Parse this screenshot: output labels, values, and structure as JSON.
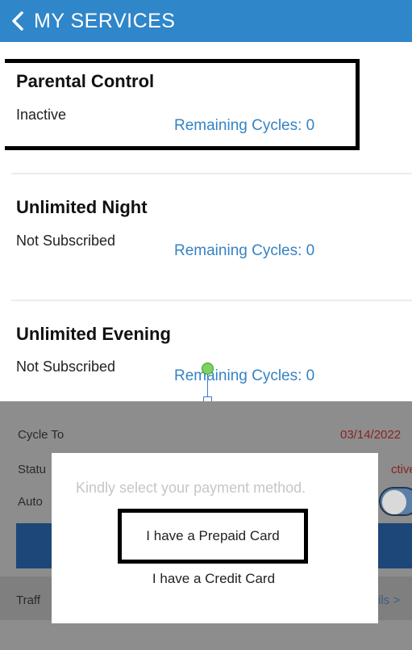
{
  "header": {
    "title": "MY SERVICES",
    "back_icon": "chevron-left-icon",
    "color": "#2f86c9"
  },
  "services": [
    {
      "title": "Parental Control",
      "status": "Inactive",
      "cycles": "Remaining Cycles: 0"
    },
    {
      "title": "Unlimited Night",
      "status": "Not Subscribed",
      "cycles": "Remaining Cycles: 0"
    },
    {
      "title": "Unlimited Evening",
      "status": "Not Subscribed",
      "cycles": "Remaining Cycles: 0"
    }
  ],
  "background_detail": {
    "cycle_to_label": "Cycle To",
    "cycle_to_value": "03/14/2022",
    "status_label": "Statu",
    "status_value": "ctive",
    "auto_label": "Auto",
    "traffic_label": "Traff",
    "details_link": "ils >"
  },
  "dialog": {
    "prompt": "Kindly select your payment method.",
    "options": [
      {
        "label": "I have a Prepaid Card"
      },
      {
        "label": "I have a Credit Card"
      }
    ]
  }
}
